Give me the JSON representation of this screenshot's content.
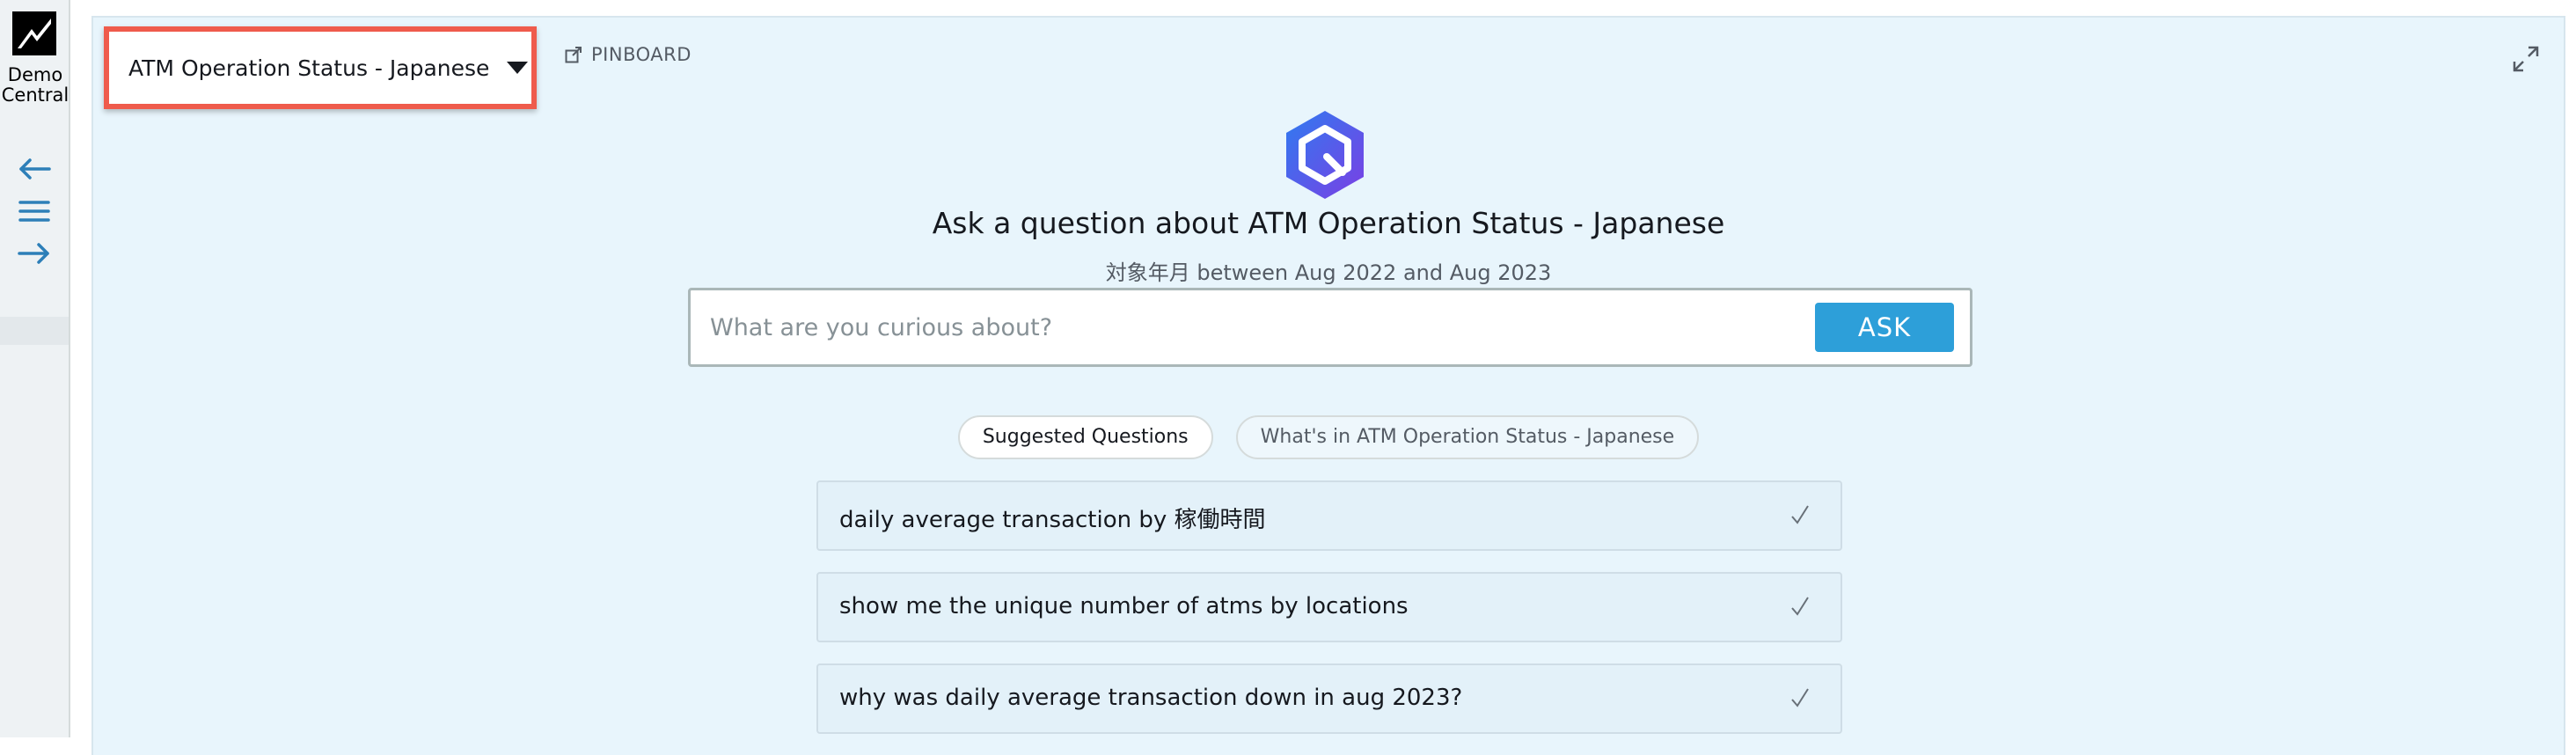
{
  "rail": {
    "brand_line1": "Demo",
    "brand_line2": "Central",
    "icons": [
      "back-arrow-icon",
      "menu-icon",
      "forward-arrow-icon"
    ],
    "accent_color": "#2d7fb8"
  },
  "header": {
    "topic_selected": "ATM Operation Status - Japanese",
    "pinboard_label": "PINBOARD"
  },
  "main": {
    "headline": "Ask a question about ATM Operation Status - Japanese",
    "date_range": "対象年月 between Aug 2022 and Aug 2023",
    "search": {
      "placeholder": "What are you curious about?",
      "value": "",
      "ask_label": "ASK"
    },
    "tabs": [
      {
        "label": "Suggested Questions",
        "active": true
      },
      {
        "label": "What's in ATM Operation Status - Japanese",
        "active": false
      }
    ],
    "suggestions": [
      {
        "text": "daily average transaction by 稼働時間"
      },
      {
        "text": "show me the unique number of atms by locations"
      },
      {
        "text": "why was daily average transaction down in aug 2023?"
      }
    ]
  },
  "colors": {
    "panel_bg": "#e8f5fc",
    "ask_button": "#2d9fd9",
    "highlight_border": "#ef5b4c",
    "logo_gradient_start": "#2f7bf0",
    "logo_gradient_end": "#7b3fe4"
  }
}
